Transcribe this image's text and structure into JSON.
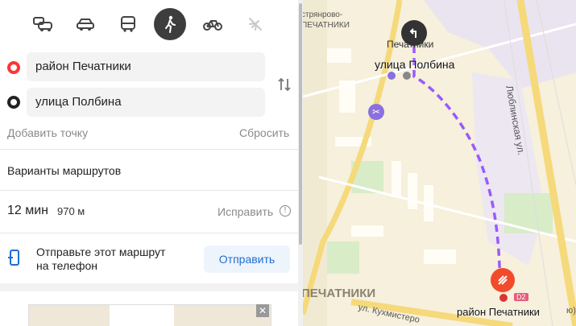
{
  "transport_modes": [
    {
      "name": "public-transport-car-icon",
      "active": false
    },
    {
      "name": "car-icon",
      "active": false
    },
    {
      "name": "bus-icon",
      "active": false
    },
    {
      "name": "pedestrian-icon",
      "active": true
    },
    {
      "name": "bicycle-icon",
      "active": false
    },
    {
      "name": "airplane-icon",
      "active": false
    }
  ],
  "route": {
    "from_value": "район Печатники",
    "to_value": "улица Полбина",
    "add_point": "Добавить точку",
    "reset": "Сбросить"
  },
  "variants_title": "Варианты маршрутов",
  "result": {
    "time": "12 мин",
    "distance": "970 м",
    "fix": "Исправить"
  },
  "send": {
    "text_line1": "Отправьте этот маршрут",
    "text_line2": "на телефон",
    "button": "Отправить"
  },
  "ad": {
    "close": "✕"
  },
  "map": {
    "street_top": "стрянрово-",
    "street_top2": "ПЕЧАТНИКИ",
    "label_pechatniki_top": "Печатники",
    "label_polbina": "улица Полбина",
    "label_lyublinskaya": "Люблинская ул.",
    "label_district": "ПЕЧАТНИКИ",
    "label_kukhmisterova": "ул. Кухмистеро",
    "label_destination": "район Печатники",
    "label_d2": "D2",
    "label_ends": "ю)",
    "route_color": "#9b59ff",
    "road_color": "#f5d97a"
  }
}
